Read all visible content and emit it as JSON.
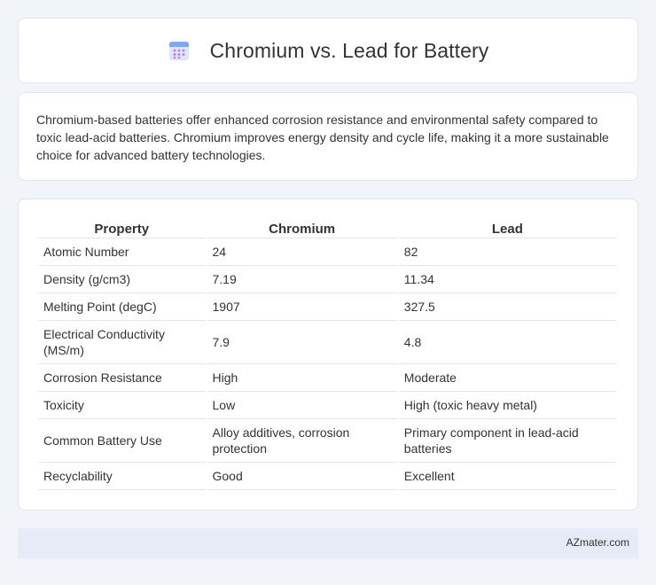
{
  "header": {
    "title": "Chromium vs. Lead for Battery",
    "icon": "calendar-grid-icon",
    "icon_colors": {
      "top": "#7ea9ee",
      "body": "#dfe6fb",
      "dots": "#c17ee0"
    }
  },
  "intro": {
    "text": "Chromium-based batteries offer enhanced corrosion resistance and environmental safety compared to toxic lead-acid batteries. Chromium improves energy density and cycle life, making it a more sustainable choice for advanced battery technologies."
  },
  "table": {
    "headers": [
      "Property",
      "Chromium",
      "Lead"
    ],
    "rows": [
      [
        "Atomic Number",
        "24",
        "82"
      ],
      [
        "Density (g/cm3)",
        "7.19",
        "11.34"
      ],
      [
        "Melting Point (degC)",
        "1907",
        "327.5"
      ],
      [
        "Electrical Conductivity (MS/m)",
        "7.9",
        "4.8"
      ],
      [
        "Corrosion Resistance",
        "High",
        "Moderate"
      ],
      [
        "Toxicity",
        "Low",
        "High (toxic heavy metal)"
      ],
      [
        "Common Battery Use",
        "Alloy additives, corrosion protection",
        "Primary component in lead-acid batteries"
      ],
      [
        "Recyclability",
        "Good",
        "Excellent"
      ]
    ]
  },
  "footer": {
    "brand": "AZmater.com"
  }
}
